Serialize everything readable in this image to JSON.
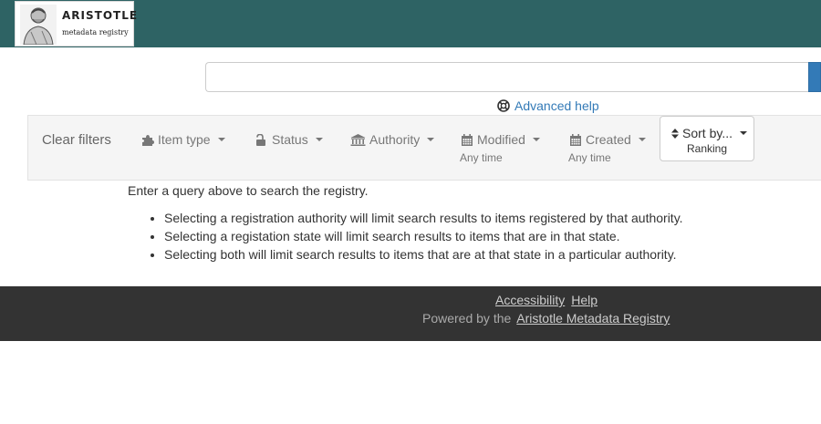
{
  "header": {
    "logo_title": "ARISTOTLE",
    "logo_subtitle": "metadata registry",
    "bg_color": "#2e6364"
  },
  "search": {
    "value": "",
    "placeholder": "",
    "advanced_help": "Advanced help",
    "button_color": "#337ab7"
  },
  "filters": {
    "clear": "Clear filters",
    "item_type": {
      "label": "Item type",
      "icon": "puzzle-icon"
    },
    "status": {
      "label": "Status",
      "icon": "unlock-icon"
    },
    "authority": {
      "label": "Authority",
      "icon": "institution-icon"
    },
    "modified": {
      "label": "Modified",
      "sub": "Any time",
      "icon": "calendar-icon"
    },
    "created": {
      "label": "Created",
      "sub": "Any time",
      "icon": "calendar-icon"
    },
    "sort": {
      "label": "Sort by...",
      "sub": "Ranking",
      "icon": "sort-icon"
    }
  },
  "main": {
    "intro": "Enter a query above to search the registry.",
    "tips": [
      "Selecting a registration authority will limit search results to items registered by that authority.",
      "Selecting a registation state will limit search results to items that are in that state.",
      "Selecting both will limit search results to items that are at that state in a particular authority."
    ]
  },
  "footer": {
    "accessibility": "Accessibility",
    "help": "Help",
    "powered_by": "Powered by the",
    "registry_link": "Aristotle Metadata Registry",
    "bg_color": "#333333"
  }
}
